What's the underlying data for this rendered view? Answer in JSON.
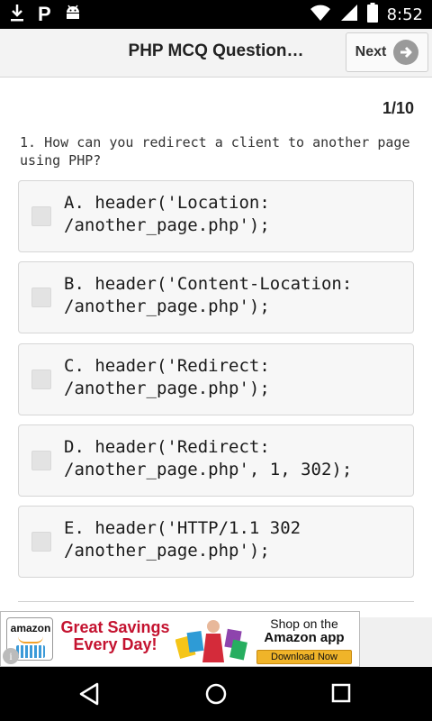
{
  "status_bar": {
    "time": "8:52",
    "left_icons": [
      "download-icon",
      "p-notification-icon",
      "android-icon"
    ],
    "right_icons": [
      "wifi-icon",
      "signal-icon",
      "battery-icon"
    ]
  },
  "action_bar": {
    "title": "PHP MCQ Question…",
    "next_label": "Next",
    "next_icon": "arrow-right-icon"
  },
  "quiz": {
    "counter": "1/10",
    "question": "1. How can you redirect a client to another page using PHP?",
    "options": [
      {
        "text": "A. header('Location:\n/another_page.php');",
        "checked": false
      },
      {
        "text": "B. header('Content-Location:\n/another_page.php');",
        "checked": false
      },
      {
        "text": "C. header('Redirect:\n/another_page.php');",
        "checked": false
      },
      {
        "text": "D. header('Redirect:\n/another_page.php', 1, 302);",
        "checked": false
      },
      {
        "text": "E. header('HTTP/1.1 302\n/another_page.php');",
        "checked": false
      }
    ]
  },
  "ad": {
    "logo_text": "amazon",
    "headline_line1": "Great Savings",
    "headline_line2": "Every Day!",
    "right_line1": "Shop on the",
    "right_line2": "Amazon app",
    "button_label": "Download Now",
    "info_glyph": "i"
  },
  "nav_bar": {
    "icons": [
      "back-icon",
      "home-icon",
      "recents-icon"
    ]
  },
  "colors": {
    "accent_red": "#c4122f",
    "button_gold": "#f0b429",
    "status_bar_bg": "#000000"
  }
}
